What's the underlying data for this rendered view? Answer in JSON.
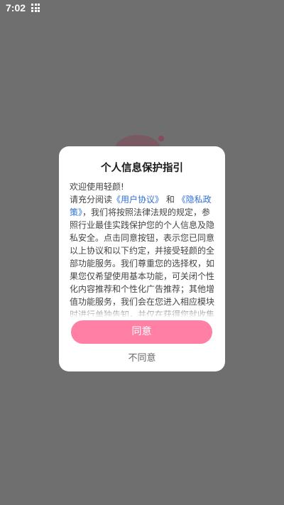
{
  "status_bar": {
    "time": "7:02",
    "grid_icon": "apps-grid-icon"
  },
  "dialog": {
    "title": "个人信息保护指引",
    "greeting": "欢迎使用轻颜!",
    "intro_prefix": "请充分阅读",
    "user_agreement_link": "《用户协议》",
    "and_text": " 和 ",
    "privacy_policy_link": "《隐私政策》",
    "body_text": "，我们将按照法律法规的规定，参照行业最佳实践保护您的个人信息及隐私安全。点击同意按钮，表示您已同意以上协议和以下约定，并接受轻颜的全部功能服务。我们尊重您的选择权，如果您仅希望使用基本功能，可关闭个性化内容推荐和个性化广告推荐；其他增值功能服务，我们会在您进入相应模块时进行单独告知，并仅在获得您就收集必要信息的授权同意后才向您提供相应服务。",
    "agree_label": "同意",
    "disagree_label": "不同意"
  },
  "colors": {
    "overlay": "#6f6f6f",
    "accent": "#ff7fa5",
    "link": "#2f6fd6"
  }
}
